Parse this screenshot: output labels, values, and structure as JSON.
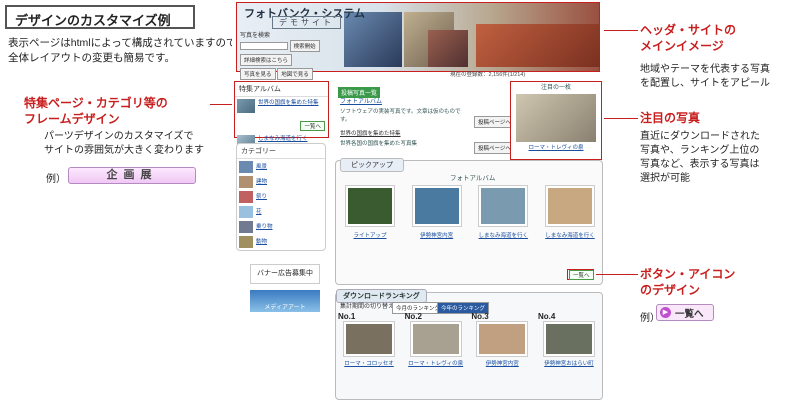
{
  "title": "デザインのカスタマイズ例",
  "intro": "表示ページはhtmlによって構成されていますので、全体レイアウトの変更も簡易です。",
  "left_annotations": {
    "frame_heading": "特集ページ・カテゴリ等の\nフレームデザイン",
    "frame_body": "パーツデザインのカスタマイズで\nサイトの雰囲気が大きく変わります",
    "example_label": "例）",
    "example_banner": "企画展"
  },
  "right_annotations": {
    "header_heading": "ヘッダ・サイトの\nメインイメージ",
    "header_body": "地域やテーマを代表する写真\nを配置し、サイトをアピール",
    "featured_heading": "注目の写真",
    "featured_body": "直近にダウンロードされた\n写真や、ランキング上位の\n写真など、表示する写真は\n選択が可能",
    "button_heading": "ボタン・アイコン\nのデザイン",
    "button_example_label": "例）",
    "button_example_text": "一覧へ"
  },
  "site": {
    "brand": "フォトバンク・システム",
    "brand_sub": "デモサイト",
    "header_left": {
      "search_label": "写真を検索",
      "search_button": "検索開始",
      "link1": "詳細検索はこちら",
      "link2": "写真を見る",
      "link3": "地図で見る"
    },
    "count_line": "現在の登録数：2,156件(1/214)",
    "tokushu": {
      "title": "特集アルバム",
      "item1": "世界の国旗を集めた特集",
      "item2": "しまなみ海道を行く",
      "more": "一覧へ"
    },
    "category": {
      "title": "カテゴリー",
      "rows": [
        "風景",
        "建物",
        "祭り",
        "花",
        "乗り物",
        "動物"
      ]
    },
    "banner_ad": "バナー広告募集中",
    "banner_ad2": "メディアアート",
    "photo_album": {
      "badge": "投稿写真一覧",
      "heading": "フォトアルバム",
      "text": "ソフトウェアの実装写真です。文章は仮のものです。",
      "button": "投稿ページへ",
      "section2": "世界の国旗を集めた特集",
      "text2": "世界各国の国旗を集めた写真集",
      "button2": "投稿ページへ"
    },
    "featured": {
      "title": "注目の一枚",
      "caption": "ローマ・トレヴィの泉"
    },
    "pickup": {
      "tab": "ピックアップ",
      "album": "フォトアルバム",
      "items": [
        {
          "caption": "ライトアップ"
        },
        {
          "caption": "伊勢神宮内宮"
        },
        {
          "caption": "しまなみ海道を行く"
        },
        {
          "caption": "しまなみ海道を行く"
        }
      ],
      "more": "一覧へ"
    },
    "ranking": {
      "tab": "ダウンロードランキング",
      "switch_label": "集計期間の切り替え",
      "btn1": "今月のランキング",
      "btn2": "今年のランキング",
      "items": [
        {
          "rank": "No.1",
          "caption": "ローマ・コロッセオ"
        },
        {
          "rank": "No.2",
          "caption": "ローマ・トレヴィの泉"
        },
        {
          "rank": "No.3",
          "caption": "伊勢神宮内宮"
        },
        {
          "rank": "No.4",
          "caption": "伊勢神宮おはらい町"
        }
      ]
    }
  },
  "colors": {
    "accent": "#c81e1e",
    "button_pink": "#f0c8f4"
  }
}
